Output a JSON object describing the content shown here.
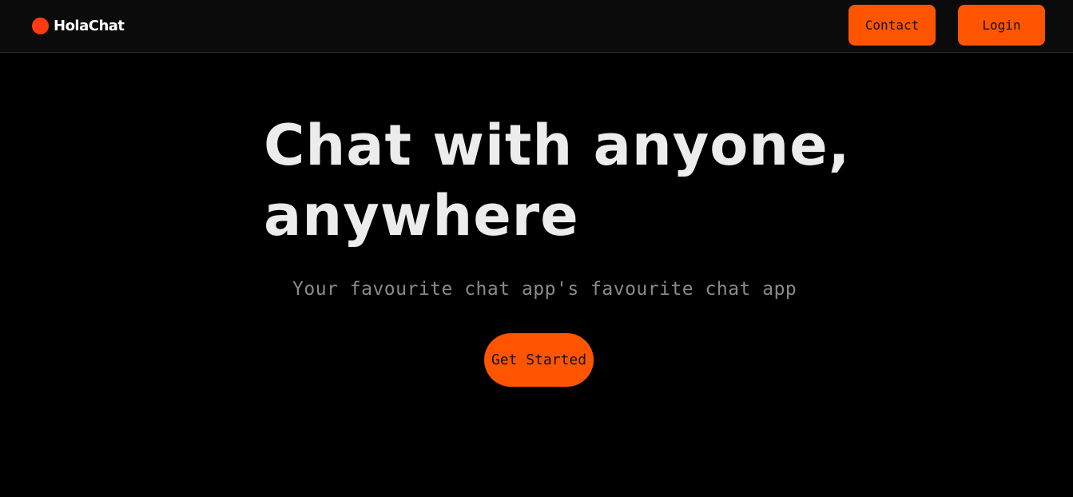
{
  "brand": {
    "name": "HolaChat",
    "accent_color": "#ff3b0f",
    "icon": "circle-logo-icon"
  },
  "nav": {
    "contact_label": "Contact",
    "login_label": "Login",
    "button_color": "#ff5500"
  },
  "hero": {
    "title_line1": "Chat with anyone,",
    "title_line2": "anywhere",
    "subtitle": "Your favourite chat app's favourite chat app",
    "cta_label": "Get Started"
  }
}
